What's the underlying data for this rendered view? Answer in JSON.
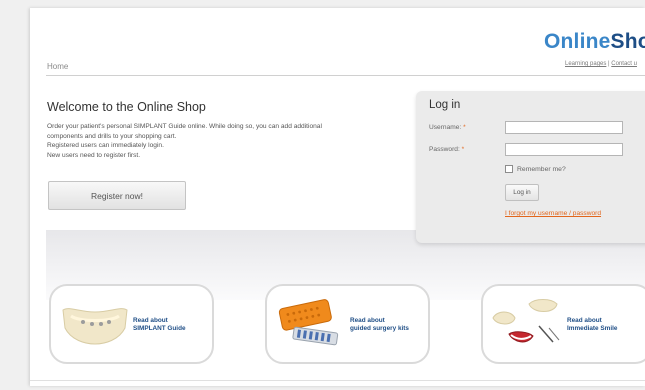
{
  "header": {
    "logo_part1": "Online",
    "logo_part2": "Shop",
    "breadcrumb": "Home",
    "link_learning": "Learning pages",
    "link_separator": " | ",
    "link_contact": "Contact u"
  },
  "welcome": {
    "title": "Welcome to the Online Shop",
    "lines": [
      "Order your patient's personal SIMPLANT Guide online. While doing so, you can add additional",
      "components and drills to your shopping cart.",
      "Registered users can immediately login.",
      "New users need to register first."
    ],
    "register_button": "Register now!"
  },
  "login": {
    "title": "Log in",
    "username_label": "Username:",
    "password_label": "Password:",
    "required_mark": "*",
    "remember_label": "Remember me?",
    "login_button": "Log in",
    "forgot_link": "I forgot my username / password"
  },
  "cards": [
    {
      "line1": "Read about",
      "line2": "SIMPLANT Guide"
    },
    {
      "line1": "Read about",
      "line2": "guided surgery kits"
    },
    {
      "line1": "Read about",
      "line2": "Immediate Smile"
    }
  ],
  "colors": {
    "brand_light": "#3a86c8",
    "brand_dark": "#1e4e86",
    "accent_orange": "#e2661c",
    "panel_bg": "#ebebeb"
  }
}
